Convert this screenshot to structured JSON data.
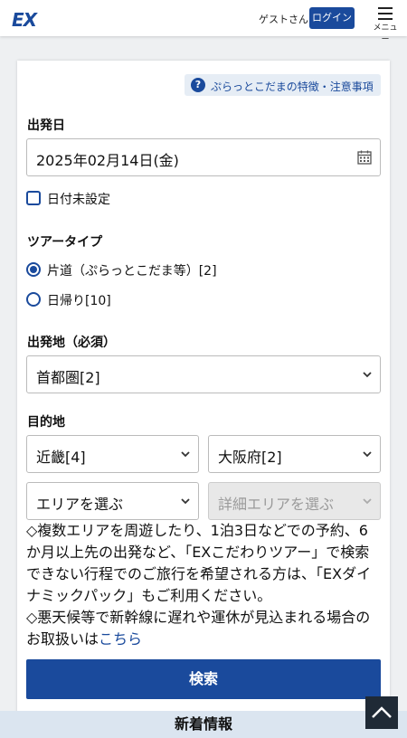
{
  "header": {
    "logo": "EX",
    "guest": "ゲストさん",
    "login": "ログイン",
    "menu": "メニュー"
  },
  "feature_link": "ぷらっとこだまの特徴・注意事項",
  "departure_date": {
    "label": "出発日",
    "value": "2025年02月14日(金)",
    "undecided_label": "日付未設定"
  },
  "tour_type": {
    "label": "ツアータイプ",
    "options": [
      {
        "label": "片道（ぷらっとこだま等）[2]",
        "selected": true
      },
      {
        "label": "日帰り[10]",
        "selected": false
      }
    ]
  },
  "origin": {
    "label": "出発地（必須）",
    "value": "首都圏[2]"
  },
  "destination": {
    "label": "目的地",
    "region": "近畿[4]",
    "prefecture": "大阪府[2]",
    "area": "エリアを選ぶ",
    "detail_area": "詳細エリアを選ぶ"
  },
  "notes": {
    "note1": "◇複数エリアを周遊したり、1泊3日などでの予約、6か月以上先の出発など、「EXこだわりツアー」で検索できない行程でのご旅行を希望される方は、「EXダイナミックパック」もご利用ください。",
    "note2": "◇悪天候等で新幹線に遅れや運休が見込まれる場合のお取扱いは",
    "note2_link": "こちら"
  },
  "search_button": "検索",
  "news_heading": "新着情報",
  "colors": {
    "brand": "#1a4a9c",
    "page_bg": "#eef0f2",
    "news_bg": "#dbe5f0"
  },
  "icons": {
    "help": "question-circle-icon",
    "calendar": "calendar-icon",
    "dropdown": "chevron-down-icon",
    "menu": "hamburger-menu-icon",
    "scroll_top": "chevron-up-icon"
  }
}
